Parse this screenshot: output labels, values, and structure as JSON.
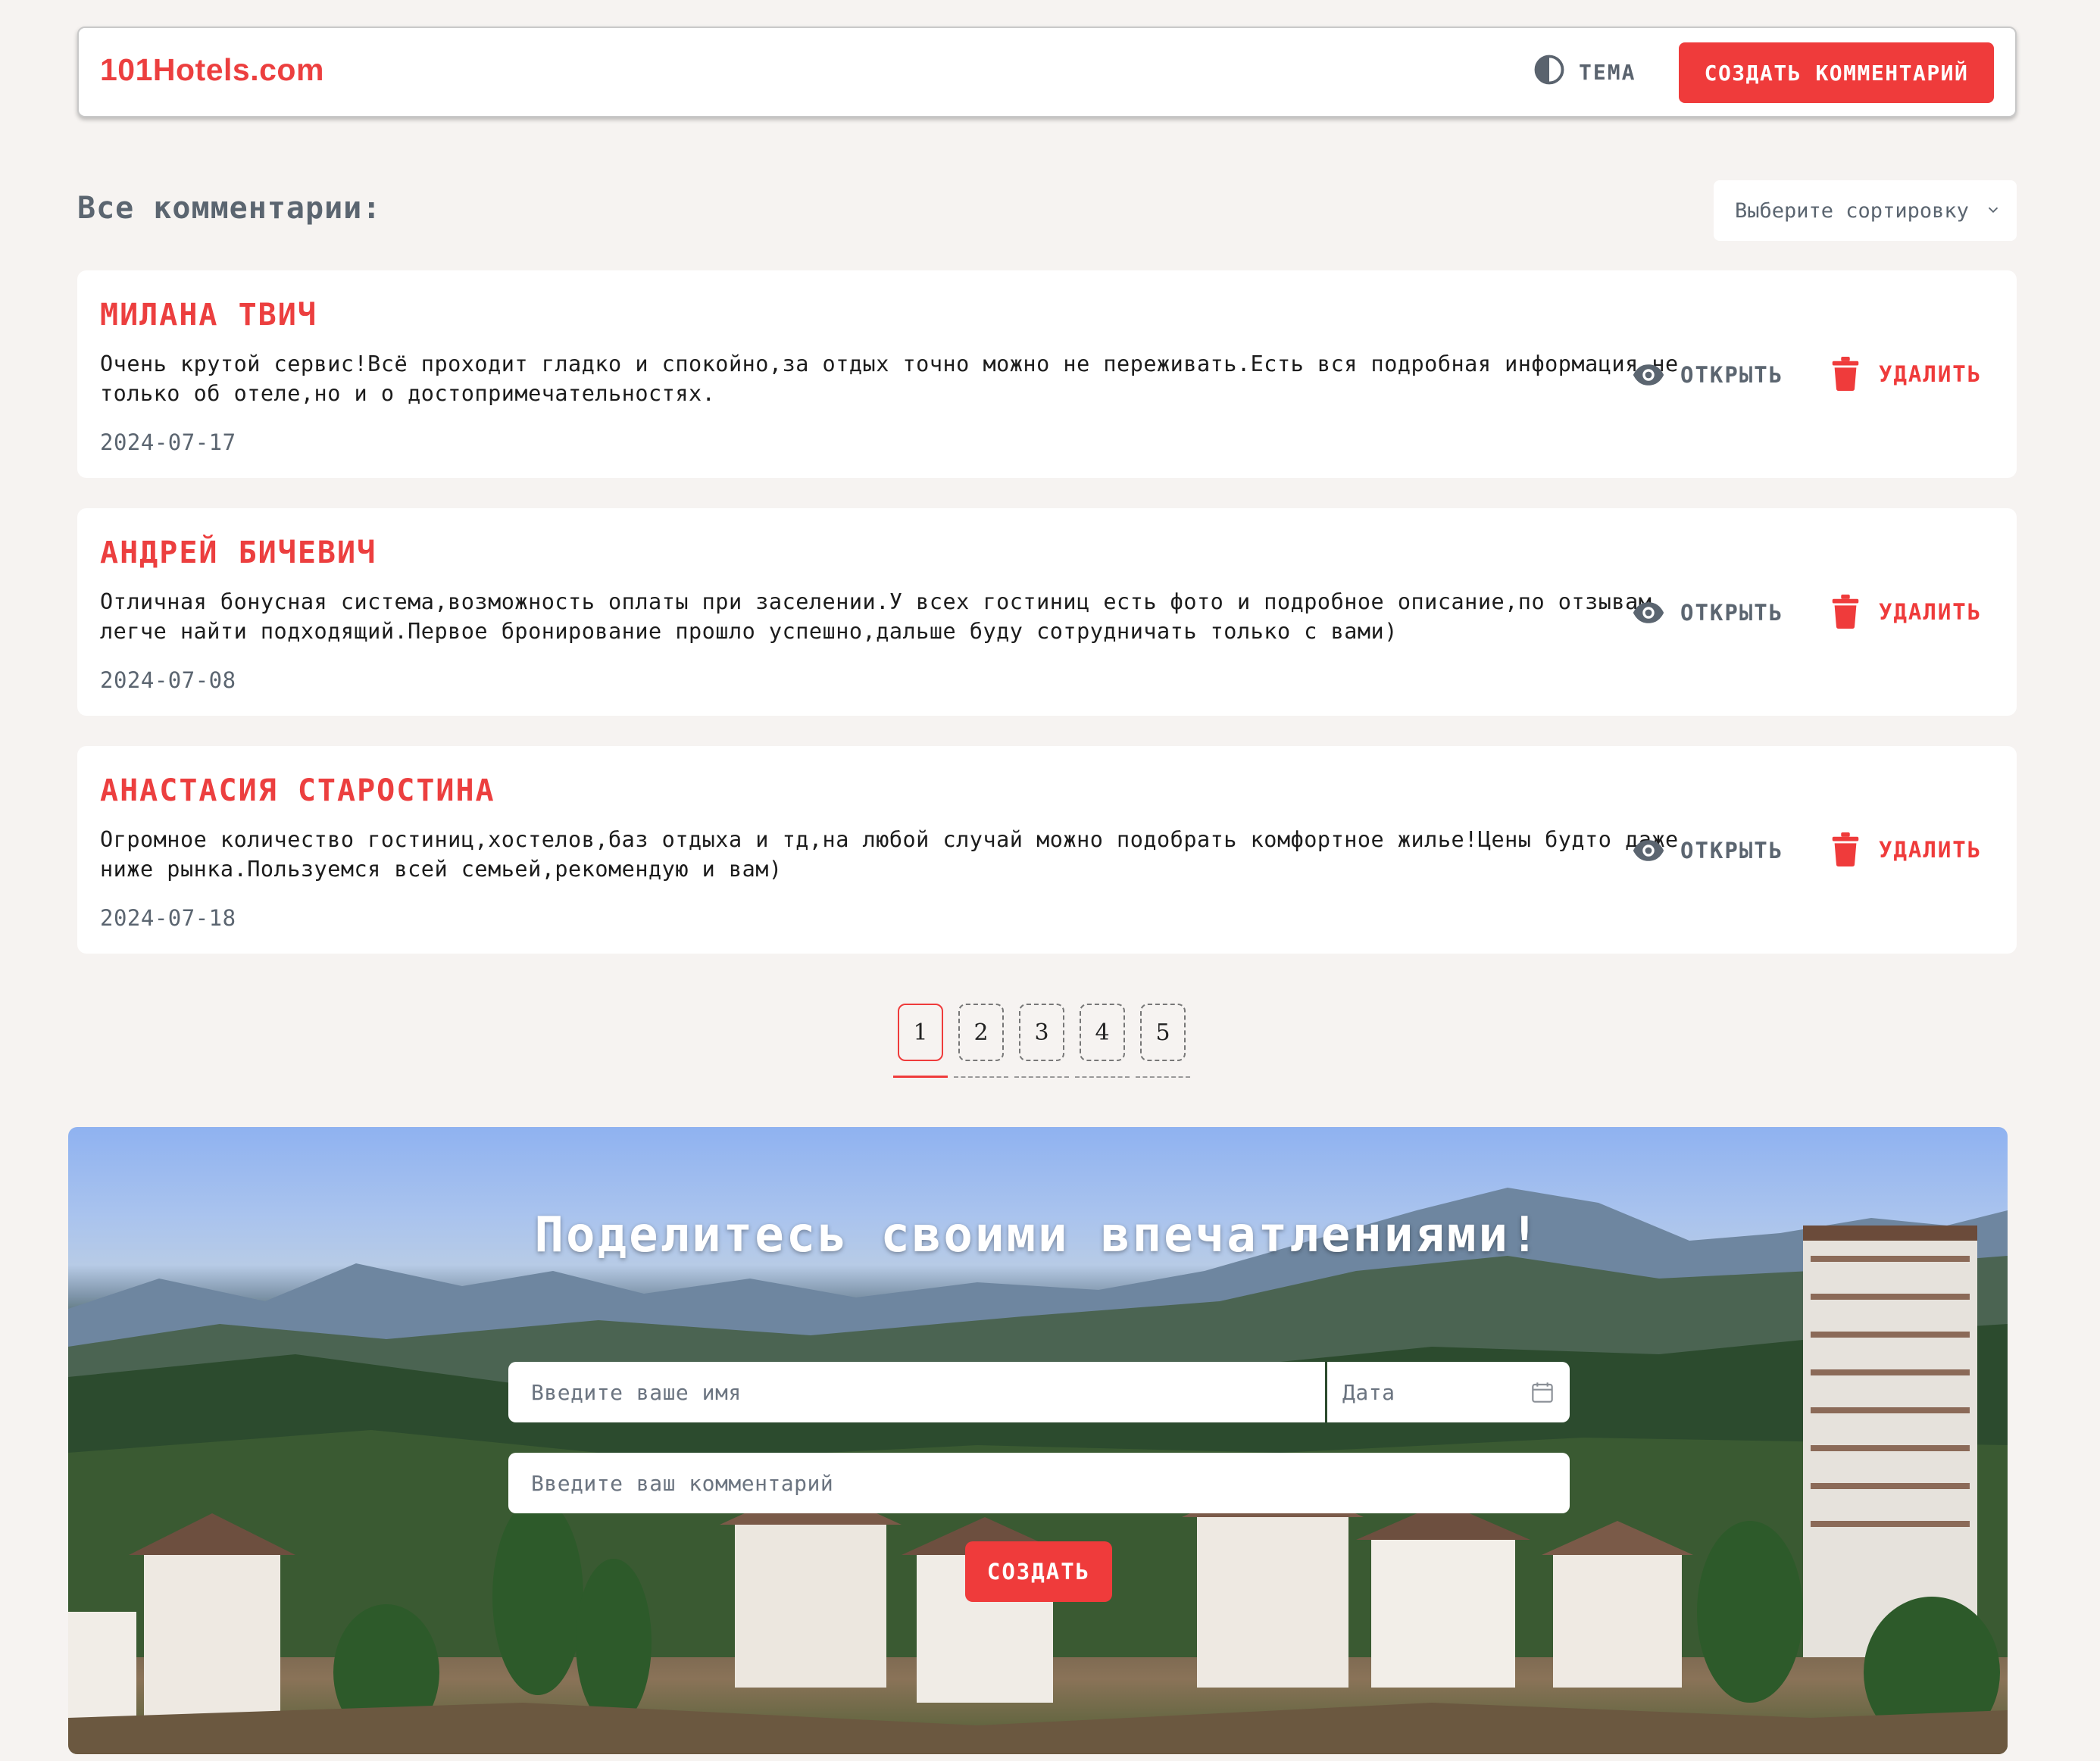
{
  "header": {
    "logo": "101Hotels.com",
    "theme_label": "ТЕМА",
    "create_button": "СОЗДАТЬ КОММЕНТАРИЙ"
  },
  "comments_section": {
    "title": "Все комментарии:",
    "sort_placeholder": "Выберите сортировку"
  },
  "comments": [
    {
      "name": "МИЛАНА ТВИЧ",
      "text": "Очень крутой сервис!Всё проходит гладко и спокойно,за отдых точно можно не переживать.Есть вся подробная информация не только об отеле,но и о достопримечательностях.",
      "date": "2024-07-17",
      "open_label": "ОТКРЫТЬ",
      "delete_label": "УДАЛИТЬ"
    },
    {
      "name": "АНДРЕЙ БИЧЕВИЧ",
      "text": "Отличная бонусная система,возможность оплаты при заселении.У всех гостиниц есть фото и подробное описание,по отзывам легче найти подходящий.Первое бронирование прошло успешно,дальше буду сотрудничать только с вами)",
      "date": "2024-07-08",
      "open_label": "ОТКРЫТЬ",
      "delete_label": "УДАЛИТЬ"
    },
    {
      "name": "АНАСТАСИЯ СТАРОСТИНА",
      "text": "Огромное количество гостиниц,хостелов,баз отдыха и тд,на любой случай можно подобрать комфортное жилье!Цены будто даже ниже рынка.Пользуемся всей семьей,рекомендую и вам)",
      "date": "2024-07-18",
      "open_label": "ОТКРЫТЬ",
      "delete_label": "УДАЛИТЬ"
    }
  ],
  "pagination": {
    "pages": [
      "1",
      "2",
      "3",
      "4",
      "5"
    ],
    "active": "1"
  },
  "form": {
    "title": "Поделитесь своими впечатлениями!",
    "name_placeholder": "Введите ваше имя",
    "date_placeholder": "Дата",
    "comment_placeholder": "Введите ваш комментарий",
    "submit_label": "СОЗДАТЬ"
  },
  "colors": {
    "accent": "#ef3b3b",
    "muted": "#5b6570",
    "background": "#f6f3f1"
  },
  "icons": {
    "theme": "contrast-icon",
    "open": "eye-icon",
    "delete": "trash-icon",
    "sort": "chevron-down-icon",
    "date": "calendar-icon"
  }
}
